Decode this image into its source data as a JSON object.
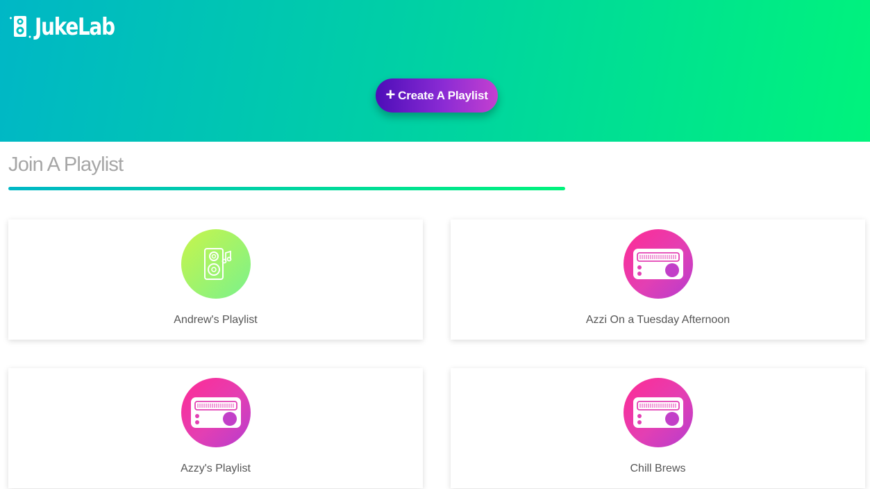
{
  "app": {
    "name": "JukeLab",
    "logo_icon": "speaker-icon"
  },
  "header": {
    "create_button_label": "Create A Playlist",
    "create_button_icon": "plus-icon",
    "gradient_colors": [
      "#00b7c6",
      "#00f37c"
    ]
  },
  "main": {
    "section_title": "Join A Playlist",
    "playlists": [
      {
        "name": "Andrew's Playlist",
        "icon": "speaker-music-icon",
        "icon_color": "green"
      },
      {
        "name": "Azzi On a Tuesday Afternoon",
        "icon": "radio-icon",
        "icon_color": "pink"
      },
      {
        "name": "Azzy's Playlist",
        "icon": "radio-icon",
        "icon_color": "pink"
      },
      {
        "name": "Chill Brews",
        "icon": "radio-icon",
        "icon_color": "pink"
      }
    ]
  },
  "colors": {
    "button_gradient": [
      "#4d0db8",
      "#c440d0"
    ],
    "pink_icon": "#ff2b94",
    "green_icon": "#c8f44a"
  }
}
